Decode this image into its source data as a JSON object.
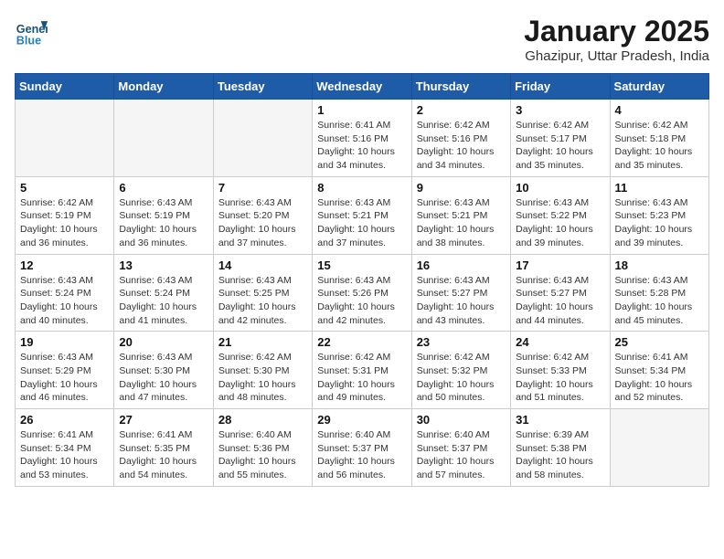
{
  "header": {
    "logo_line1": "General",
    "logo_line2": "Blue",
    "month_year": "January 2025",
    "location": "Ghazipur, Uttar Pradesh, India"
  },
  "days_of_week": [
    "Sunday",
    "Monday",
    "Tuesday",
    "Wednesday",
    "Thursday",
    "Friday",
    "Saturday"
  ],
  "weeks": [
    [
      {
        "day": "",
        "info": ""
      },
      {
        "day": "",
        "info": ""
      },
      {
        "day": "",
        "info": ""
      },
      {
        "day": "1",
        "info": "Sunrise: 6:41 AM\nSunset: 5:16 PM\nDaylight: 10 hours\nand 34 minutes."
      },
      {
        "day": "2",
        "info": "Sunrise: 6:42 AM\nSunset: 5:16 PM\nDaylight: 10 hours\nand 34 minutes."
      },
      {
        "day": "3",
        "info": "Sunrise: 6:42 AM\nSunset: 5:17 PM\nDaylight: 10 hours\nand 35 minutes."
      },
      {
        "day": "4",
        "info": "Sunrise: 6:42 AM\nSunset: 5:18 PM\nDaylight: 10 hours\nand 35 minutes."
      }
    ],
    [
      {
        "day": "5",
        "info": "Sunrise: 6:42 AM\nSunset: 5:19 PM\nDaylight: 10 hours\nand 36 minutes."
      },
      {
        "day": "6",
        "info": "Sunrise: 6:43 AM\nSunset: 5:19 PM\nDaylight: 10 hours\nand 36 minutes."
      },
      {
        "day": "7",
        "info": "Sunrise: 6:43 AM\nSunset: 5:20 PM\nDaylight: 10 hours\nand 37 minutes."
      },
      {
        "day": "8",
        "info": "Sunrise: 6:43 AM\nSunset: 5:21 PM\nDaylight: 10 hours\nand 37 minutes."
      },
      {
        "day": "9",
        "info": "Sunrise: 6:43 AM\nSunset: 5:21 PM\nDaylight: 10 hours\nand 38 minutes."
      },
      {
        "day": "10",
        "info": "Sunrise: 6:43 AM\nSunset: 5:22 PM\nDaylight: 10 hours\nand 39 minutes."
      },
      {
        "day": "11",
        "info": "Sunrise: 6:43 AM\nSunset: 5:23 PM\nDaylight: 10 hours\nand 39 minutes."
      }
    ],
    [
      {
        "day": "12",
        "info": "Sunrise: 6:43 AM\nSunset: 5:24 PM\nDaylight: 10 hours\nand 40 minutes."
      },
      {
        "day": "13",
        "info": "Sunrise: 6:43 AM\nSunset: 5:24 PM\nDaylight: 10 hours\nand 41 minutes."
      },
      {
        "day": "14",
        "info": "Sunrise: 6:43 AM\nSunset: 5:25 PM\nDaylight: 10 hours\nand 42 minutes."
      },
      {
        "day": "15",
        "info": "Sunrise: 6:43 AM\nSunset: 5:26 PM\nDaylight: 10 hours\nand 42 minutes."
      },
      {
        "day": "16",
        "info": "Sunrise: 6:43 AM\nSunset: 5:27 PM\nDaylight: 10 hours\nand 43 minutes."
      },
      {
        "day": "17",
        "info": "Sunrise: 6:43 AM\nSunset: 5:27 PM\nDaylight: 10 hours\nand 44 minutes."
      },
      {
        "day": "18",
        "info": "Sunrise: 6:43 AM\nSunset: 5:28 PM\nDaylight: 10 hours\nand 45 minutes."
      }
    ],
    [
      {
        "day": "19",
        "info": "Sunrise: 6:43 AM\nSunset: 5:29 PM\nDaylight: 10 hours\nand 46 minutes."
      },
      {
        "day": "20",
        "info": "Sunrise: 6:43 AM\nSunset: 5:30 PM\nDaylight: 10 hours\nand 47 minutes."
      },
      {
        "day": "21",
        "info": "Sunrise: 6:42 AM\nSunset: 5:30 PM\nDaylight: 10 hours\nand 48 minutes."
      },
      {
        "day": "22",
        "info": "Sunrise: 6:42 AM\nSunset: 5:31 PM\nDaylight: 10 hours\nand 49 minutes."
      },
      {
        "day": "23",
        "info": "Sunrise: 6:42 AM\nSunset: 5:32 PM\nDaylight: 10 hours\nand 50 minutes."
      },
      {
        "day": "24",
        "info": "Sunrise: 6:42 AM\nSunset: 5:33 PM\nDaylight: 10 hours\nand 51 minutes."
      },
      {
        "day": "25",
        "info": "Sunrise: 6:41 AM\nSunset: 5:34 PM\nDaylight: 10 hours\nand 52 minutes."
      }
    ],
    [
      {
        "day": "26",
        "info": "Sunrise: 6:41 AM\nSunset: 5:34 PM\nDaylight: 10 hours\nand 53 minutes."
      },
      {
        "day": "27",
        "info": "Sunrise: 6:41 AM\nSunset: 5:35 PM\nDaylight: 10 hours\nand 54 minutes."
      },
      {
        "day": "28",
        "info": "Sunrise: 6:40 AM\nSunset: 5:36 PM\nDaylight: 10 hours\nand 55 minutes."
      },
      {
        "day": "29",
        "info": "Sunrise: 6:40 AM\nSunset: 5:37 PM\nDaylight: 10 hours\nand 56 minutes."
      },
      {
        "day": "30",
        "info": "Sunrise: 6:40 AM\nSunset: 5:37 PM\nDaylight: 10 hours\nand 57 minutes."
      },
      {
        "day": "31",
        "info": "Sunrise: 6:39 AM\nSunset: 5:38 PM\nDaylight: 10 hours\nand 58 minutes."
      },
      {
        "day": "",
        "info": ""
      }
    ]
  ]
}
